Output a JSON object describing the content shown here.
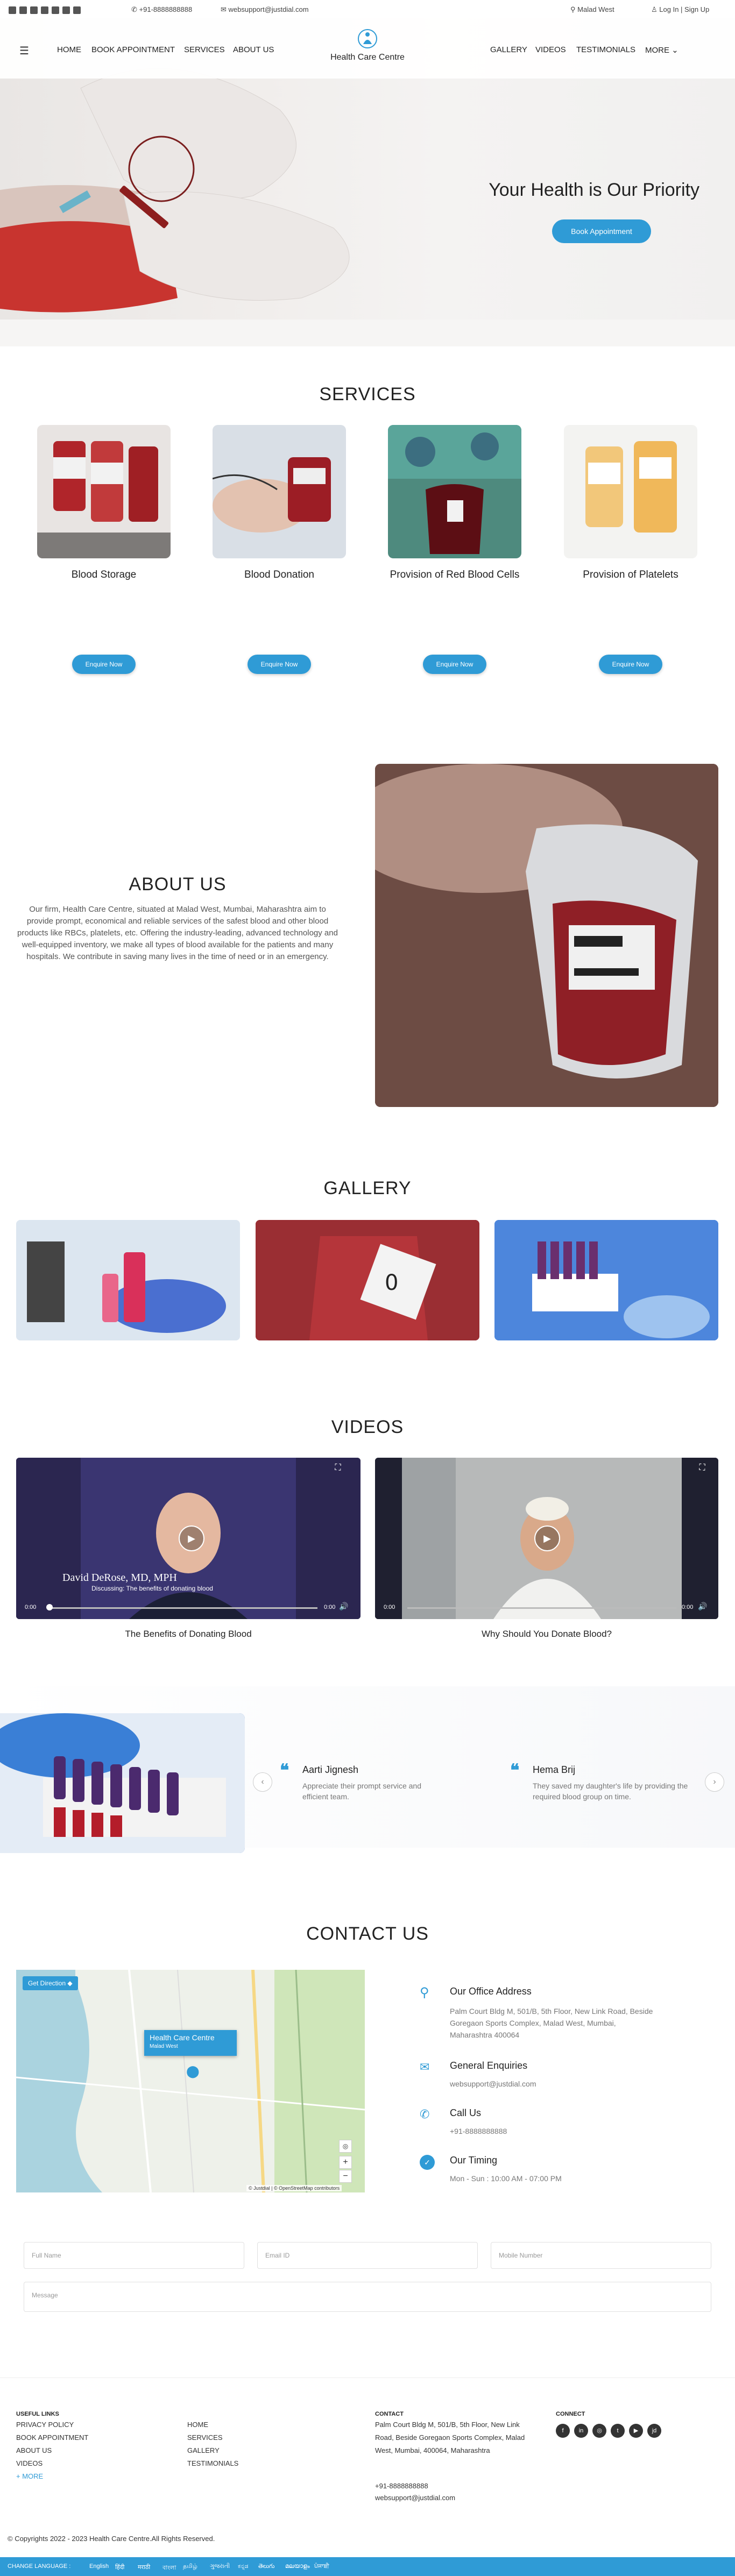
{
  "topbar": {
    "phone": "+91-8888888888",
    "email": "websupport@justdial.com",
    "location": "Malad West",
    "login": "Log In | Sign Up"
  },
  "nav": {
    "left": [
      "HOME",
      "BOOK APPOINTMENT",
      "SERVICES",
      "ABOUT US"
    ],
    "brand": "Health Care Centre",
    "right": [
      "GALLERY",
      "VIDEOS",
      "TESTIMONIALS"
    ],
    "more": "MORE"
  },
  "hero": {
    "title": "Your Health is Our Priority",
    "button": "Book Appointment"
  },
  "services": {
    "heading": "SERVICES",
    "items": [
      {
        "title": "Blood Storage",
        "button": "Enquire Now"
      },
      {
        "title": "Blood Donation",
        "button": "Enquire Now"
      },
      {
        "title": "Provision of Red Blood Cells",
        "button": "Enquire Now"
      },
      {
        "title": "Provision of Platelets",
        "button": "Enquire Now"
      }
    ]
  },
  "about": {
    "heading": "ABOUT US",
    "text": "Our firm, Health Care Centre, situated at Malad West, Mumbai, Maharashtra aim to provide prompt, economical and reliable services of the safest blood and other blood products like RBCs, platelets, etc. Offering the industry-leading, advanced technology and well-equipped inventory, we make all types of blood available for the patients and many hospitals. We contribute in saving many lives in the time of need or in an emergency."
  },
  "gallery": {
    "heading": "GALLERY"
  },
  "videos": {
    "heading": "VIDEOS",
    "items": [
      {
        "caption": "The Benefits of Donating Blood",
        "overlay_name": "David DeRose, MD, MPH",
        "overlay_line": "Discussing: The benefits of donating blood",
        "time_start": "0:00",
        "time_end": "0:00"
      },
      {
        "caption": "Why Should You Donate Blood?",
        "time_start": "0:00",
        "time_end": "0:00"
      }
    ]
  },
  "testimonials": {
    "items": [
      {
        "name": "Aarti Jignesh",
        "text": "Appreciate their prompt service and efficient team."
      },
      {
        "name": "Hema Brij",
        "text": "They saved my daughter's life by providing the required blood group on time."
      }
    ]
  },
  "contact": {
    "heading": "CONTACT US",
    "map": {
      "directions": "Get Direction",
      "pin_title": "Health Care Centre",
      "pin_sub": "Malad West",
      "attribution": "© Justdial | © OpenStreetMap contributors"
    },
    "office_title": "Our Office Address",
    "office_text": "Palm Court Bldg M, 501/B, 5th Floor, New Link Road, Beside Goregaon Sports Complex, Malad West, Mumbai, Maharashtra 400064",
    "enq_title": "General Enquiries",
    "enq_text": "websupport@justdial.com",
    "call_title": "Call Us",
    "call_text": "+91-8888888888",
    "time_title": "Our Timing",
    "time_text": "Mon - Sun : 10:00 AM - 07:00 PM",
    "form": {
      "name": "Full Name",
      "email": "Email ID",
      "mobile": "Mobile Number",
      "message": "Message"
    }
  },
  "footer": {
    "useful_heading": "USEFUL LINKS",
    "useful_col1": [
      "PRIVACY POLICY",
      "BOOK APPOINTMENT",
      "ABOUT US",
      "VIDEOS"
    ],
    "more": "+ MORE",
    "useful_col2": [
      "HOME",
      "SERVICES",
      "GALLERY",
      "TESTIMONIALS"
    ],
    "contact_heading": "CONTACT",
    "contact_address": "Palm Court Bldg M, 501/B, 5th Floor, New Link Road, Beside Goregaon Sports Complex, Malad West, Mumbai, 400064, Maharashtra",
    "contact_phone": "+91-8888888888",
    "contact_email": "websupport@justdial.com",
    "connect_heading": "CONNECT",
    "copyright": "© Copyrights 2022 - 2023 Health Care Centre.All Rights Reserved.",
    "language_label": "CHANGE LANGUAGE :",
    "languages": [
      "English",
      "हिंदी",
      "मराठी",
      "বাংলা",
      "தமிழ்",
      "ગુજરાતી",
      "ಕನ್ನಡ",
      "తెలుగు",
      "മലയാളം",
      "ਪੰਜਾਬੀ"
    ]
  },
  "colors": {
    "accent": "#2f9bd6",
    "footer_bar": "#2f9bd6"
  }
}
